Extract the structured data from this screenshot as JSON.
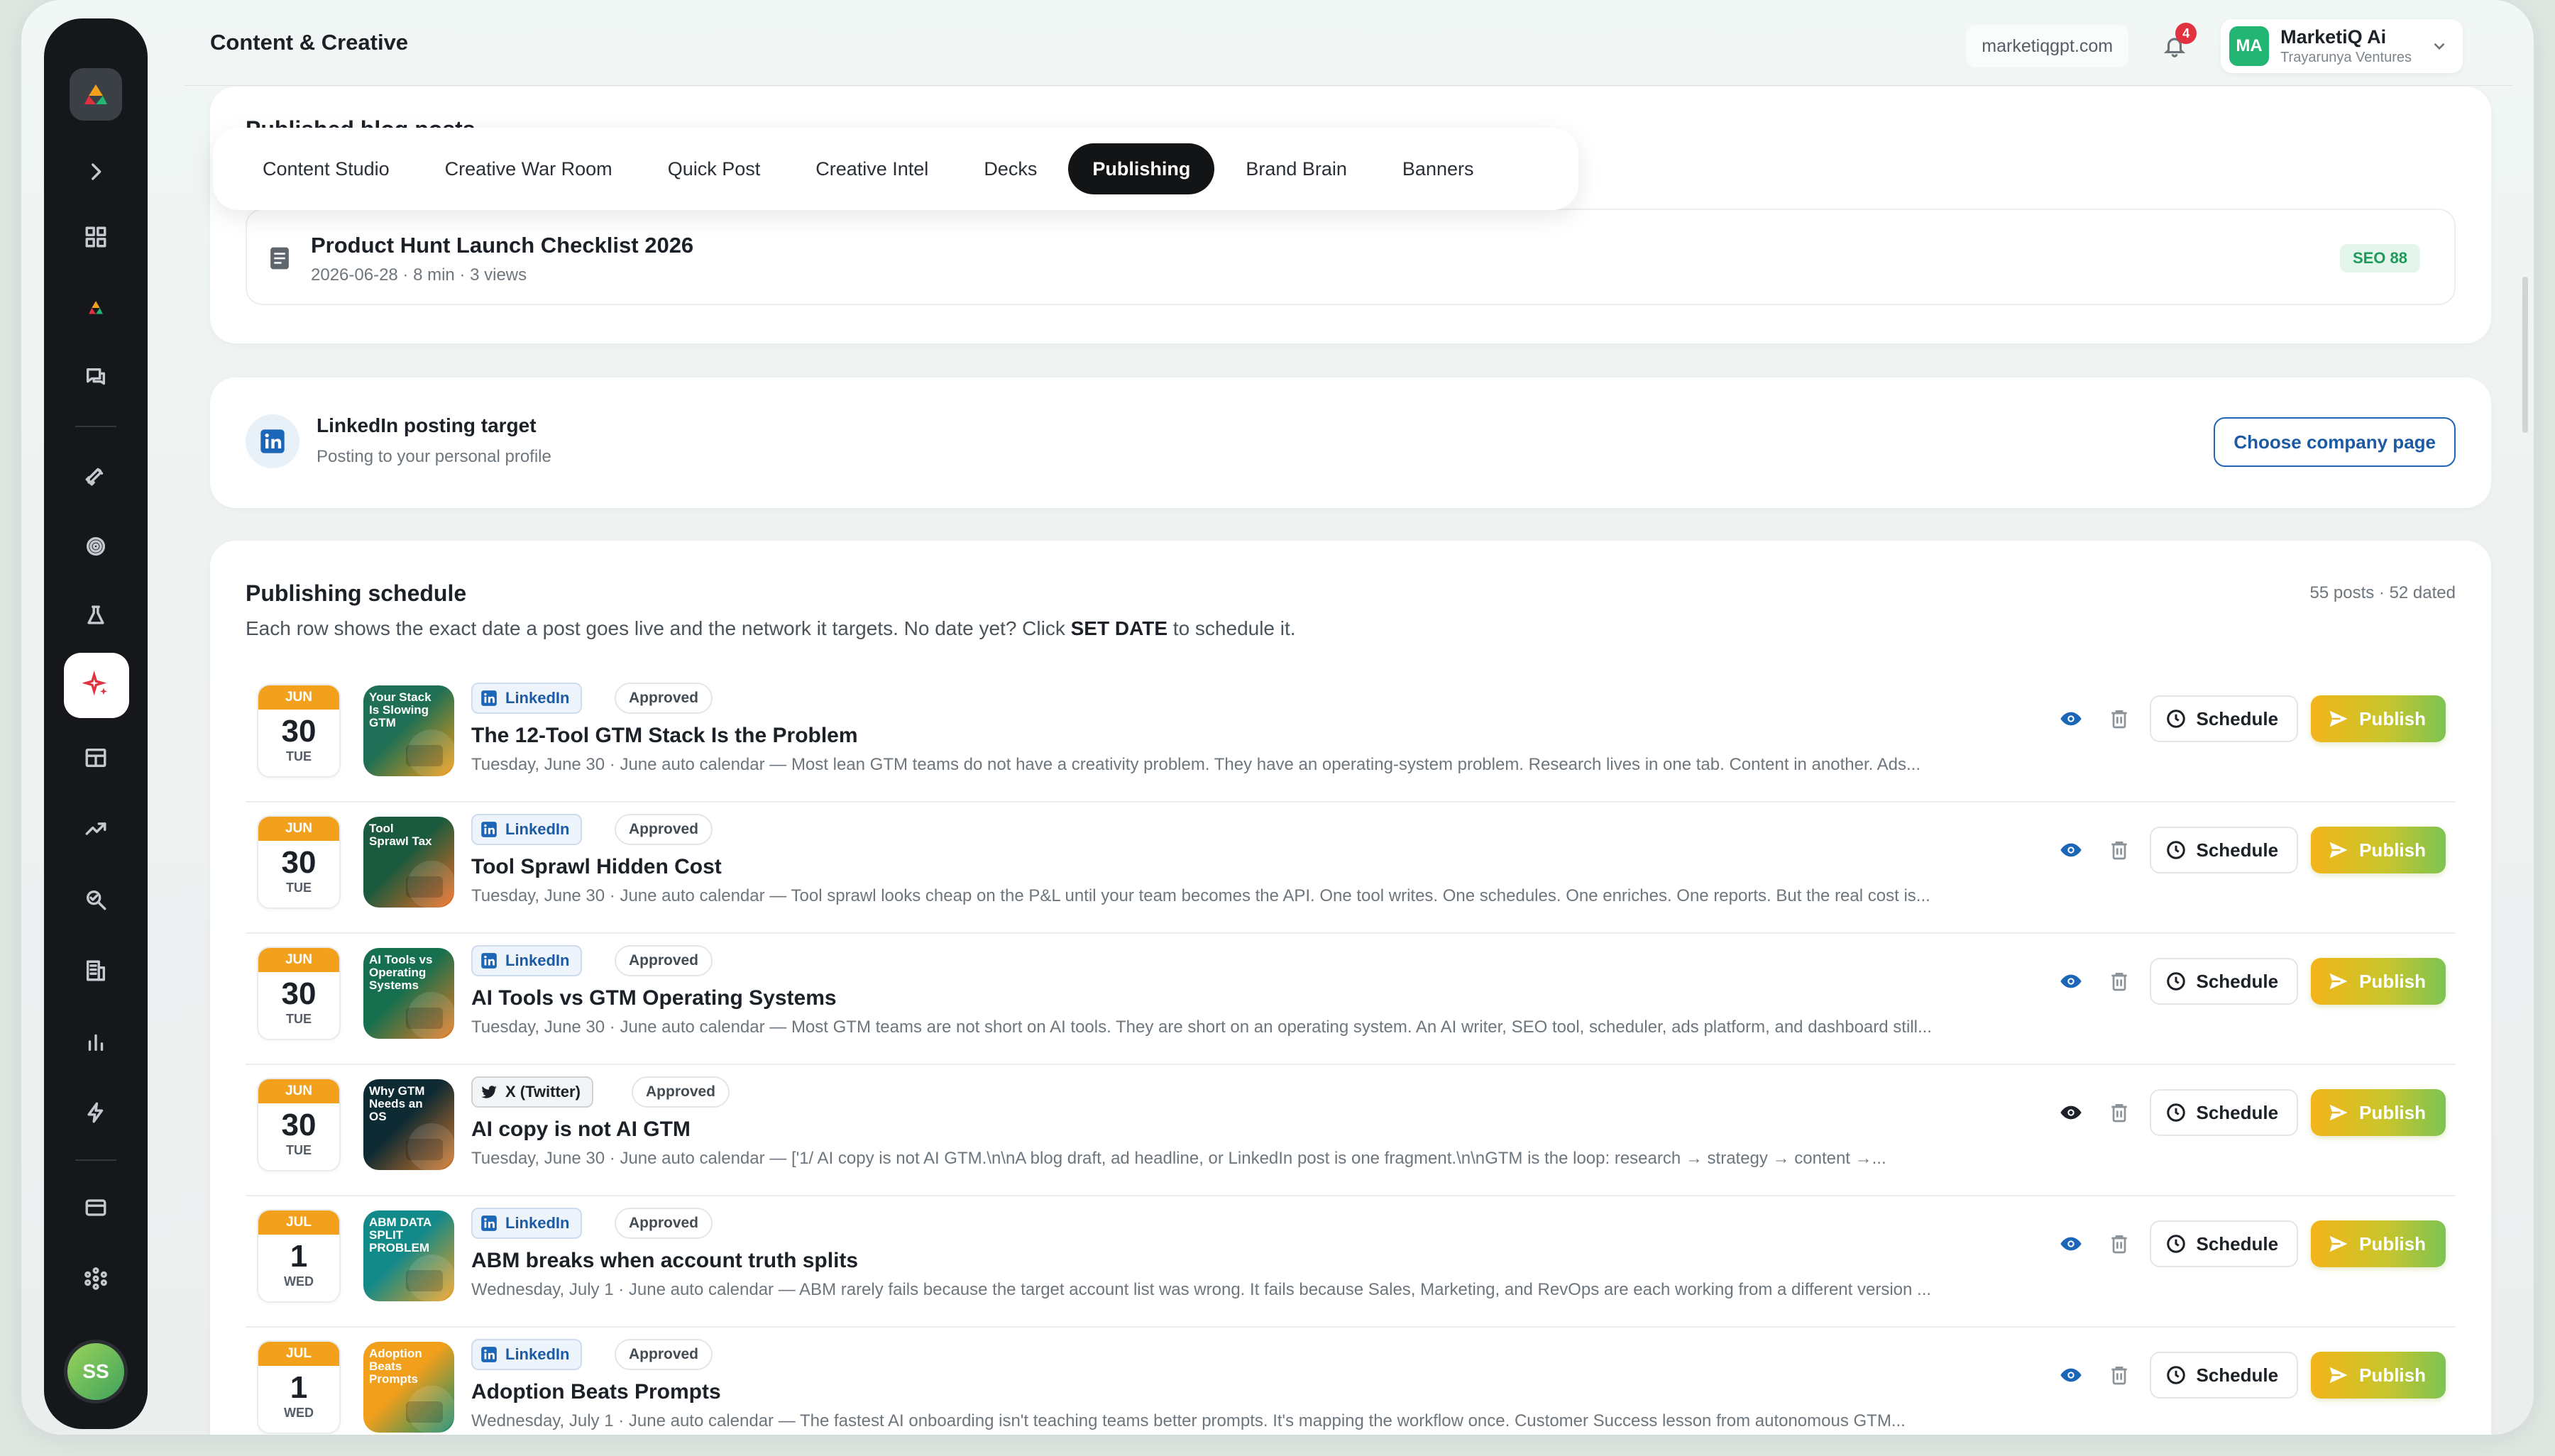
{
  "header": {
    "title": "Content & Creative",
    "domain": "marketiqgpt.com",
    "notifications": "4",
    "account": {
      "initials": "MA",
      "name": "MarketiQ Ai",
      "org": "Trayarunya Ventures"
    }
  },
  "sidebar": {
    "avatar_initials": "SS",
    "items": [
      "expand",
      "dashboard",
      "logo",
      "chat",
      "launch",
      "fingerprint",
      "lab",
      "creative",
      "layout",
      "trends",
      "analyze",
      "company",
      "analytics",
      "automations",
      "billing",
      "integrations"
    ]
  },
  "published": {
    "heading": "Published blog posts",
    "post": {
      "title": "Product Hunt Launch Checklist 2026",
      "meta": "2026-06-28 · 8 min · 3 views",
      "seo": "SEO 88"
    }
  },
  "tabs": [
    "Content Studio",
    "Creative War Room",
    "Quick Post",
    "Creative Intel",
    "Decks",
    "Publishing",
    "Brand Brain",
    "Banners"
  ],
  "active_tab": "Publishing",
  "linkedin_target": {
    "title": "LinkedIn posting target",
    "subtitle": "Posting to your personal profile",
    "button": "Choose company page"
  },
  "schedule": {
    "title": "Publishing schedule",
    "count": "55 posts · 52 dated",
    "desc_before": "Each row shows the exact date a post goes live and the network it targets. No date yet? Click ",
    "desc_bold": "SET DATE",
    "desc_after": " to schedule it.",
    "schedule_label": "Schedule",
    "publish_label": "Publish",
    "rows": [
      {
        "month": "JUN",
        "day": "30",
        "dow": "TUE",
        "network": "LinkedIn",
        "status": "Approved",
        "title": "The 12-Tool GTM Stack Is the Problem",
        "desc": "Tuesday, June 30 · June auto calendar — Most lean GTM teams do not have a creativity problem. They have an operating-system problem. Research lives in one tab. Content in another. Ads...",
        "thumb_text": "Your Stack Is Slowing GTM",
        "thumb_colors": [
          "#1e6f55",
          "#f39c12"
        ]
      },
      {
        "month": "JUN",
        "day": "30",
        "dow": "TUE",
        "network": "LinkedIn",
        "status": "Approved",
        "title": "Tool Sprawl Hidden Cost",
        "desc": "Tuesday, June 30 · June auto calendar — Tool sprawl looks cheap on the P&L until your team becomes the API. One tool writes. One schedules. One enriches. One reports. But the real cost is...",
        "thumb_text": "Tool Sprawl Tax",
        "thumb_colors": [
          "#1a5a3e",
          "#f26b1d"
        ]
      },
      {
        "month": "JUN",
        "day": "30",
        "dow": "TUE",
        "network": "LinkedIn",
        "status": "Approved",
        "title": "AI Tools vs GTM Operating Systems",
        "desc": "Tuesday, June 30 · June auto calendar — Most GTM teams are not short on AI tools. They are short on an operating system. An AI writer, SEO tool, scheduler, ads platform, and dashboard still...",
        "thumb_text": "AI Tools vs Operating Systems",
        "thumb_colors": [
          "#16704f",
          "#e87a1e"
        ]
      },
      {
        "month": "JUN",
        "day": "30",
        "dow": "TUE",
        "network": "X (Twitter)",
        "status": "Approved",
        "title": "AI copy is not AI GTM",
        "desc": "Tuesday, June 30 · June auto calendar — ['1/ AI copy is not AI GTM.\\n\\nA blog draft, ad headline, or LinkedIn post is one fragment.\\n\\nGTM is the loop: research → strategy → content →...",
        "thumb_text": "Why GTM Needs an OS",
        "thumb_colors": [
          "#0e2a33",
          "#d4792a"
        ]
      },
      {
        "month": "JUL",
        "day": "1",
        "dow": "WED",
        "network": "LinkedIn",
        "status": "Approved",
        "title": "ABM breaks when account truth splits",
        "desc": "Wednesday, July 1 · June auto calendar — ABM rarely fails because the target account list was wrong. It fails because Sales, Marketing, and RevOps are each working from a different version ...",
        "thumb_text": "ABM DATA SPLIT PROBLEM",
        "thumb_colors": [
          "#138a8a",
          "#f2a01c"
        ]
      },
      {
        "month": "JUL",
        "day": "1",
        "dow": "WED",
        "network": "LinkedIn",
        "status": "Approved",
        "title": "Adoption Beats Prompts",
        "desc": "Wednesday, July 1 · June auto calendar — The fastest AI onboarding isn't teaching teams better prompts. It's mapping the workflow once. Customer Success lesson from autonomous GTM...",
        "thumb_text": "Adoption Beats Prompts",
        "thumb_colors": [
          "#f2a01c",
          "#138a6a"
        ]
      }
    ]
  }
}
